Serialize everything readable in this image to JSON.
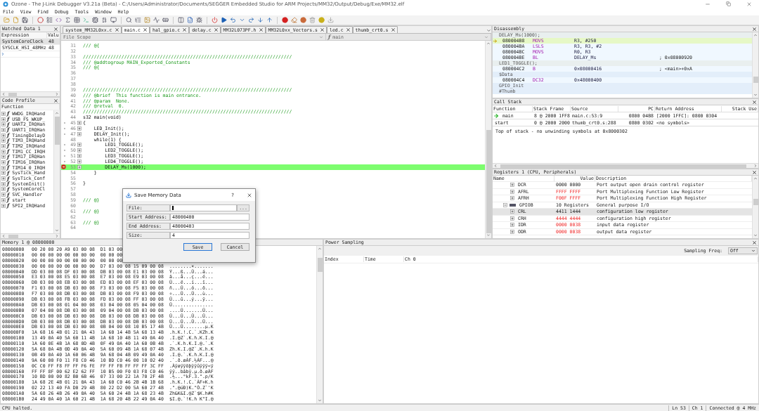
{
  "window": {
    "title": "Ozone - The J-Link Debugger V3.21a (Beta) - C:/Users/Administrator/Documents/SEGGER Embedded Studio for ARM Projects/MM32/Output/Debug/Exe/MM32.elf"
  },
  "menu": [
    "File",
    "View",
    "Find",
    "Debug",
    "Tools",
    "Window",
    "Help"
  ],
  "watched_data": {
    "title": "Watched Data 1",
    "columns": [
      "Expression",
      "Valu"
    ],
    "rows": [
      {
        "expression": "SystemCoreClock",
        "value": "48",
        "selected": true
      },
      {
        "expression": "SYSCLK_HSI_48MHz",
        "value": "48",
        "selected": false
      }
    ]
  },
  "code_profile": {
    "title": "Code Profile",
    "columns": [
      "Function"
    ],
    "functions": [
      {
        "glyph": "ƒ",
        "name": "WWDG_IRQHand"
      },
      {
        "glyph": "ƒ",
        "name": "USB_FS_WKUP_"
      },
      {
        "glyph": "ƒ",
        "name": "UART2_IRQHan"
      },
      {
        "glyph": "ƒ",
        "name": "UART1_IRQHan"
      },
      {
        "glyph": "ƒ",
        "name": "TimingDelayD"
      },
      {
        "glyph": "ƒ",
        "name": "TIM3_IRQHand"
      },
      {
        "glyph": "ƒ",
        "name": "TIM2_IRQHand"
      },
      {
        "glyph": "ƒ",
        "name": "TIM1_CC_IRQH"
      },
      {
        "glyph": "ƒ",
        "name": "TIM17_IRQHan"
      },
      {
        "glyph": "ƒ",
        "name": "TIM16_IRQHan"
      },
      {
        "glyph": "ƒ",
        "name": "TIM14_0_IRQH"
      },
      {
        "glyph": "ƒ",
        "name": "SysTick_Hand"
      },
      {
        "glyph": "ƒ",
        "name": "SysTick_Conf"
      },
      {
        "glyph": "ƒ",
        "name": "SystemInit()"
      },
      {
        "glyph": "ƒ",
        "name": "SystemCoreCl"
      },
      {
        "glyph": "ƒ",
        "name": "SVC_Handler"
      },
      {
        "glyph": "ƒ",
        "name": "start"
      },
      {
        "glyph": "ƒ",
        "name": "SPI2_IRQHand"
      }
    ]
  },
  "source": {
    "tabs": [
      {
        "label": "system_MM32L0xx.c",
        "selected": false
      },
      {
        "label": "main.c",
        "selected": true
      },
      {
        "label": "hal_gpio.c",
        "selected": false
      },
      {
        "label": "delay.c",
        "selected": false
      },
      {
        "label": "MM32L073PF.h",
        "selected": false
      },
      {
        "label": "MM32L0xx_Vectors.s",
        "selected": false
      },
      {
        "label": "led.c",
        "selected": false
      },
      {
        "label": "thumb_crt0.s",
        "selected": false
      }
    ],
    "scope": "File Scope",
    "function_glyph": "ƒ",
    "function": "main",
    "lines": [
      {
        "number": "31",
        "text": "/// @{",
        "kind": "comment",
        "executable": false,
        "breakpoint": false,
        "current": false
      },
      {
        "number": "32",
        "kind": "blank",
        "executable": false,
        "breakpoint": false,
        "current": false
      },
      {
        "number": "33",
        "text": "////////////////////////////////////////////////////////////////////////////",
        "kind": "comment",
        "executable": false,
        "breakpoint": false,
        "current": false
      },
      {
        "number": "34",
        "text": "/// @addtogroup MAIN_Exported_Constants",
        "kind": "comment",
        "executable": false,
        "breakpoint": false,
        "current": false
      },
      {
        "number": "35",
        "text": "/// @{",
        "kind": "comment",
        "executable": false,
        "breakpoint": false,
        "current": false
      },
      {
        "number": "36",
        "kind": "blank",
        "executable": false,
        "breakpoint": false,
        "current": false
      },
      {
        "number": "37",
        "kind": "blank",
        "executable": false,
        "breakpoint": false,
        "current": false
      },
      {
        "number": "38",
        "kind": "blank",
        "executable": false,
        "breakpoint": false,
        "current": false
      },
      {
        "number": "39",
        "text": "////////////////////////////////////////////////////////////////////////////",
        "kind": "comment",
        "executable": false,
        "breakpoint": false,
        "current": false
      },
      {
        "number": "40",
        "text": "/// @brief  This function is main entrance.",
        "kind": "comment",
        "executable": false,
        "breakpoint": false,
        "current": false
      },
      {
        "number": "41",
        "text": "/// @param  None.",
        "kind": "comment",
        "executable": false,
        "breakpoint": false,
        "current": false
      },
      {
        "number": "42",
        "text": "/// @retval  0.",
        "kind": "comment",
        "executable": false,
        "breakpoint": false,
        "current": false
      },
      {
        "number": "43",
        "text": "////////////////////////////////////////////////////////////////////////////",
        "kind": "comment",
        "executable": false,
        "breakpoint": false,
        "current": false
      },
      {
        "number": "44",
        "text": "s32 main(void)",
        "kind": "code",
        "executable": false,
        "breakpoint": false,
        "current": false
      },
      {
        "number": "45",
        "text": "{",
        "kind": "code",
        "executable": true,
        "breakpoint": false,
        "current": false
      },
      {
        "number": "46",
        "text": "    LED_Init();",
        "kind": "code",
        "executable": true,
        "breakpoint": false,
        "current": false
      },
      {
        "number": "47",
        "text": "    DELAY_Init();",
        "kind": "code",
        "executable": true,
        "breakpoint": false,
        "current": false
      },
      {
        "number": "48",
        "text": "    while(1) {",
        "kind": "code",
        "executable": false,
        "breakpoint": false,
        "current": false
      },
      {
        "number": "49",
        "text": "        LED1_TOGGLE();",
        "kind": "code",
        "executable": true,
        "breakpoint": false,
        "current": false
      },
      {
        "number": "50",
        "text": "        LED2_TOGGLE();",
        "kind": "code",
        "executable": true,
        "breakpoint": false,
        "current": false
      },
      {
        "number": "51",
        "text": "        LED3_TOGGLE();",
        "kind": "code",
        "executable": true,
        "breakpoint": false,
        "current": false
      },
      {
        "number": "52",
        "text": "        LED4_TOGGLE();",
        "kind": "code",
        "executable": true,
        "breakpoint": false,
        "current": false
      },
      {
        "number": "53",
        "text": "        DELAY_Ms(1000);",
        "kind": "code",
        "executable": true,
        "breakpoint": true,
        "current": true
      },
      {
        "number": "54",
        "text": "    }",
        "kind": "code",
        "executable": false,
        "breakpoint": false,
        "current": false
      },
      {
        "number": "55",
        "kind": "blank",
        "executable": false,
        "breakpoint": false,
        "current": false
      },
      {
        "number": "56",
        "text": "}",
        "kind": "code",
        "executable": false,
        "breakpoint": false,
        "current": false
      },
      {
        "number": "57",
        "kind": "blank",
        "executable": false,
        "breakpoint": false,
        "current": false
      },
      {
        "number": "58",
        "kind": "blank",
        "executable": false,
        "breakpoint": false,
        "current": false
      },
      {
        "number": "59",
        "text": "/// @}",
        "kind": "comment",
        "executable": false,
        "breakpoint": false,
        "current": false
      },
      {
        "number": "60",
        "kind": "blank",
        "executable": false,
        "breakpoint": false,
        "current": false
      },
      {
        "number": "61",
        "text": "/// @}",
        "kind": "comment",
        "executable": false,
        "breakpoint": false,
        "current": false
      },
      {
        "number": "62",
        "kind": "blank",
        "executable": false,
        "breakpoint": false,
        "current": false
      },
      {
        "number": "63",
        "text": "/// @}",
        "kind": "comment",
        "executable": false,
        "breakpoint": false,
        "current": false
      },
      {
        "number": "64",
        "kind": "blank",
        "executable": false,
        "breakpoint": false,
        "current": false
      }
    ]
  },
  "disassembly": {
    "title": "Disassembly",
    "rows": [
      {
        "kind": "source",
        "text": "DELAY_Ms(1000);",
        "current": false
      },
      {
        "kind": "instruction",
        "address": "080004B8",
        "mnemonic": "MOVS",
        "operands": "R3, #250",
        "current": true
      },
      {
        "kind": "instruction",
        "address": "080004BA",
        "mnemonic": "LSLS",
        "operands": "R3, R3, #2",
        "current": false
      },
      {
        "kind": "instruction",
        "address": "080004BC",
        "mnemonic": "MOVS",
        "operands": "R0, R3",
        "current": false
      },
      {
        "kind": "instruction",
        "address": "080004BE",
        "mnemonic": "BL",
        "operands": "DELAY_Ms",
        "comment": "; 0x08000920",
        "current": false
      },
      {
        "kind": "source",
        "text": "LED1_TOGGLE();",
        "current": false
      },
      {
        "kind": "instruction",
        "address": "080004C2",
        "mnemonic": "B",
        "operands": "0x08000416",
        "comment": "; <main>+0xA",
        "current": false
      },
      {
        "kind": "label",
        "text": "$Data",
        "current": false
      },
      {
        "kind": "instruction",
        "address": "080004C4",
        "mnemonic": "DC32",
        "operands": "0x48000400",
        "current": false
      },
      {
        "kind": "label",
        "text": "GPIO_Init",
        "current": false
      },
      {
        "kind": "label",
        "text": "#Thumb",
        "current": false
      }
    ]
  },
  "call_stack": {
    "title": "Call Stack",
    "columns": [
      "Function",
      "Stack Frame",
      "Source",
      "PC",
      "Return Address",
      "Stack Use"
    ],
    "rows": [
      {
        "function": "main",
        "frame": "8 @ 2000 1FF8",
        "source": "main.c:53:9",
        "pc": "0800 04B8",
        "return_address": "[2000 1FFC]: 0800 0304",
        "current": true
      },
      {
        "function": "start",
        "frame": "0 @ 2000 2000",
        "source": "thumb_crt0.s:288",
        "pc": "0800 0302",
        "return_address": "<no symbols>",
        "current": false
      }
    ],
    "note": "Top of stack - no unwinding symbols at 0x8000302"
  },
  "registers": {
    "title": "Registers 1 (CPU, Peripherals)",
    "columns": [
      "Name",
      "Value",
      "Description"
    ],
    "rows": [
      {
        "name": "DCR",
        "value": "0000 0000",
        "description": "Port output open drain control register",
        "changed": false,
        "expanded": false,
        "selected": false
      },
      {
        "name": "AFRL",
        "value": "FFFF FFFF",
        "description": "Port Multiplexing Function Low Register",
        "changed": true,
        "expanded": false,
        "selected": false
      },
      {
        "name": "AFRH",
        "value": "F00F FFFF",
        "description": "Port Multiplexing Function High Register",
        "changed": true,
        "expanded": false,
        "selected": false
      },
      {
        "name": "GPIOB",
        "value": "10 Registers",
        "description": "General purpose I/O",
        "changed": false,
        "expanded": true,
        "selected": false,
        "children": [
          {
            "name": "CRL",
            "value": "4411 1444",
            "description": "configuration low register",
            "changed": false,
            "expanded": false,
            "selected": true
          },
          {
            "name": "CRH",
            "value": "4444 4444",
            "description": "configuration high register",
            "changed": true,
            "expanded": false,
            "selected": false
          },
          {
            "name": "IDR",
            "value": "0000 0038",
            "description": "input data register",
            "changed": true,
            "expanded": false,
            "selected": false
          },
          {
            "name": "ODR",
            "value": "0000 0038",
            "description": "output data register",
            "changed": true,
            "expanded": false,
            "selected": false
          }
        ]
      }
    ]
  },
  "memory": {
    "title": "Memory 1 @ 08000000",
    "rows": [
      {
        "address": "08000000",
        "hex": "00 20 00 20 A9 03 00 08  D1 03 00"
      },
      {
        "address": "08000010",
        "hex": "00 00 00 00 00 00 00 00  00 00 00"
      },
      {
        "address": "08000020",
        "hex": "00 00 00 00 00 00 00 00  00 00 00"
      },
      {
        "address": "08000030",
        "hex": "00 00 00 00 00 00 00 00  D7 03 00 08 15 09 00 08",
        "ascii": "........×......."
      },
      {
        "address": "08000040",
        "hex": "DD 03 00 08 DF 03 00 08  DB 03 00 08 E1 03 00 08",
        "ascii": "Ý...ß...Û...á..."
      },
      {
        "address": "08000050",
        "hex": "E3 03 00 08 E5 03 00 08  E7 03 00 08 E9 03 00 08",
        "ascii": "ã...å...ç...é..."
      },
      {
        "address": "08000060",
        "hex": "DB 03 00 08 EB 03 00 08  ED 03 00 08 EF 03 00 08",
        "ascii": "Û...ë...í...ï..."
      },
      {
        "address": "08000070",
        "hex": "F1 03 00 08 DB 03 00 08  F3 03 00 08 F5 03 00 08",
        "ascii": "ñ...Û...ó...õ..."
      },
      {
        "address": "08000080",
        "hex": "F7 03 00 08 DB 03 00 08  DB 03 00 08 F9 03 00 08",
        "ascii": "÷...Û...Û...ù..."
      },
      {
        "address": "08000090",
        "hex": "DB 03 00 08 FB 03 00 08  FD 03 00 08 FF 03 00 08",
        "ascii": "Û...û...ý...ÿ..."
      },
      {
        "address": "080000A0",
        "hex": "DB 03 00 08 01 04 00 08  03 04 00 08 05 04 00 08",
        "ascii": "Û..............."
      },
      {
        "address": "080000B0",
        "hex": "07 04 00 08 DB 03 00 08  09 04 00 08 DB 03 00 08",
        "ascii": "....Û.......Û..."
      },
      {
        "address": "080000C0",
        "hex": "DB 03 00 08 DB 03 00 08  DB 03 00 08 DB 03 00 08",
        "ascii": "Û...Û...Û...Û..."
      },
      {
        "address": "080000D0",
        "hex": "DB 03 00 08 DB 03 00 08  DB 03 00 08 DB 03 00 08",
        "ascii": "Û...Û...Û...Û..."
      },
      {
        "address": "080000E0",
        "hex": "DB 03 00 08 DB 03 00 08  0B 04 00 08 10 B5 17 4B",
        "ascii": "Û...Û........µ.K"
      },
      {
        "address": "080000F0",
        "hex": "1A 68 16 4B 01 21 0A 43  1A 60 14 4B 5A 68 13 4B",
        "ascii": ".h.K.!.C.`.KZh.K"
      },
      {
        "address": "08000100",
        "hex": "13 49 0A 40 5A 60 11 4B  1A 68 10 4B 11 49 0A 40",
        "ascii": ".I.@Z`.K.h.K.I.@"
      },
      {
        "address": "08000110",
        "hex": "1A 60 0E 4B 1A 68 0D 4B  0F 49 0A 40 1A 60 0B 4B",
        "ascii": ".`.K.h.K.I.@.`.K"
      },
      {
        "address": "08000120",
        "hex": "5A 68 0A 4B 0D 49 0A 40  5A 60 09 4B 1A 68 07 4B",
        "ascii": "Zh.K.I.@Z`.K.h.K"
      },
      {
        "address": "08000130",
        "hex": "0B 49 0A 40 1A 60 06 4B  9A 68 04 4B 09 49 0A 40",
        "ascii": ".I.@.`.K.h.K.I.@"
      },
      {
        "address": "08000140",
        "hex": "9A 60 00 F0 11 F8 C0 46  10 BD C0 46 00 10 02 40",
        "ascii": ".`.ð.øÀF.½ÀF...@"
      },
      {
        "address": "08000150",
        "hex": "0C C0 FF F8 FF FF F6 FE  FF FF FB FF FF FF 3C FF",
        "ascii": ".Àÿøÿÿöþÿÿûÿÿÿ<ÿ"
      },
      {
        "address": "08000160",
        "hex": "FF FF 8F 00 62 E2 62 FF  10 B5 00 F0 03 F8 C0 46",
        "ascii": "ÿÿ..bâbÿ.µ.ð.øÀF"
      },
      {
        "address": "08000170",
        "hex": "10 BD 00 00 82 B0 6B 46  07 33 00 22 1A 70 2F 4B",
        "ascii": ".½...°kF.3.\".p/K"
      },
      {
        "address": "08000180",
        "hex": "1A 68 2E 4B 01 21 0A 43  1A 60 C0 46 2B 4B 1B 68",
        "ascii": ".h.K.!.C.`ÀF+K.h"
      },
      {
        "address": "08000190",
        "hex": "02 22 13 40 FA D0 29 4B  80 22 D2 00 5A 60 27 4B",
        "ascii": ".\".@úÐ)K.\"Ò.Z`'K"
      },
      {
        "address": "080001A0",
        "hex": "5A 68 26 4B 26 49 0A 40  5A 60 24 4B 1A 68 23 4B",
        "ascii": "Zh&K&I.@Z`$K.h#K"
      },
      {
        "address": "080001B0",
        "hex": "24 49 0A 40 1A 60 21 4B  1A 68 20 4B 22 49 0A 40",
        "ascii": "$I.@.`!K.h K\"I.@"
      }
    ]
  },
  "dialog": {
    "title": "Save Memory Data",
    "help": "?",
    "fields": [
      {
        "label": "File:",
        "browse": "..."
      },
      {
        "label": "Start Address:",
        "value": "48000400"
      },
      {
        "label": "End Address:",
        "value": "48000403"
      },
      {
        "label": "Size:",
        "value": "4"
      }
    ],
    "buttons": [
      {
        "label": "Save",
        "default": true
      },
      {
        "label": "Cancel",
        "default": false
      }
    ]
  },
  "power_sampling": {
    "title": "Power Sampling",
    "freq_label": "Sampling Freq:",
    "freq_value": "Off",
    "columns": [
      "Index",
      "Time",
      "Ch 0"
    ]
  },
  "status_bar": {
    "message": "CPU halted.",
    "line": "Ln 53",
    "column": "Ch 1",
    "connection": "Connected @ 4 MHz"
  }
}
